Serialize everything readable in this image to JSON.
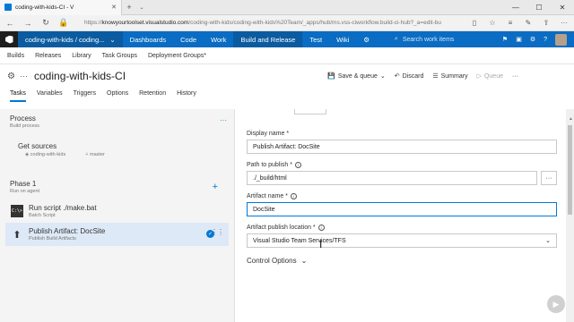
{
  "browser": {
    "tab_title": "coding-with-kids-CI - V",
    "url_prefix": "https://",
    "url_host": "knowyourtoolset.visualstudio.com",
    "url_path": "/coding-with-kids/coding-with-kids%20Team/_apps/hub/ms.vss-ciworkflow.build-ci-hub?_a=edit-bu"
  },
  "header": {
    "project": "coding-with-kids / coding...",
    "menu": [
      "Dashboards",
      "Code",
      "Work",
      "Build and Release",
      "Test",
      "Wiki"
    ],
    "active_menu": "Build and Release",
    "search_placeholder": "Search work items"
  },
  "subnav": [
    "Builds",
    "Releases",
    "Library",
    "Task Groups",
    "Deployment Groups*"
  ],
  "pipeline": {
    "name": "coding-with-kids-CI",
    "save_label": "Save & queue",
    "discard_label": "Discard",
    "summary_label": "Summary",
    "queue_label": "Queue"
  },
  "tabs": [
    "Tasks",
    "Variables",
    "Triggers",
    "Options",
    "Retention",
    "History"
  ],
  "active_tab": "Tasks",
  "left": {
    "process_title": "Process",
    "process_sub": "Build process",
    "get_sources_title": "Get sources",
    "repo": "coding-with-kids",
    "branch": "master",
    "phase_title": "Phase 1",
    "phase_sub": "Run on agent",
    "tasks": [
      {
        "title": "Run script ./make.bat",
        "sub": "Batch Script",
        "icon": "script-icon"
      },
      {
        "title": "Publish Artifact: DocSite",
        "sub": "Publish Build Artifacts",
        "icon": "upload-icon"
      }
    ]
  },
  "form": {
    "display_name_label": "Display name *",
    "display_name_value": "Publish Artifact: DocSite",
    "path_label": "Path to publish *",
    "path_value": "./_build/html",
    "artifact_name_label": "Artifact name *",
    "artifact_name_value": "DocSite",
    "location_label": "Artifact publish location *",
    "location_value": "Visual Studio Team Services/TFS",
    "control_options": "Control Options"
  },
  "colors": {
    "accent": "#0078d7",
    "header_blue": "#0a6cc2",
    "project_blue": "#0a5ba0"
  }
}
